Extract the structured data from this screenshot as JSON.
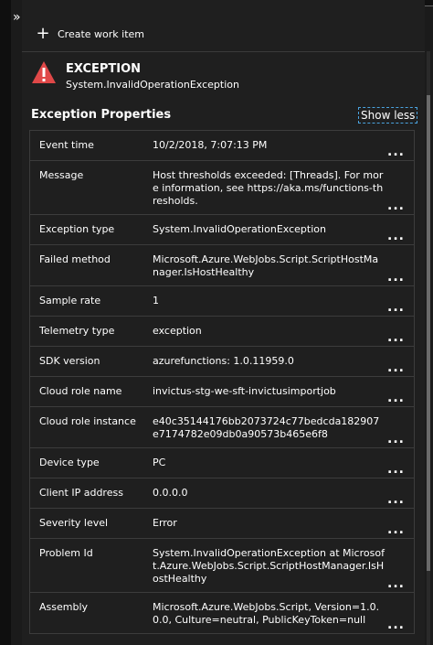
{
  "rail": {
    "expand_glyph": "»"
  },
  "toolbar": {
    "create_label": "Create work item",
    "create_icon": "plus-icon"
  },
  "exception": {
    "title": "EXCEPTION",
    "type": "System.InvalidOperationException",
    "icon": "warning-icon",
    "icon_color": "#e04848"
  },
  "section": {
    "title": "Exception Properties",
    "toggle_label": "Show less"
  },
  "properties": [
    {
      "key": "Event time",
      "value": "10/2/2018, 7:07:13 PM"
    },
    {
      "key": "Message",
      "value": "Host thresholds exceeded: [Threads]. For more information, see https://aka.ms/functions-thresholds."
    },
    {
      "key": "Exception type",
      "value": "System.InvalidOperationException"
    },
    {
      "key": "Failed method",
      "value": "Microsoft.Azure.WebJobs.Script.ScriptHostManager.IsHostHealthy"
    },
    {
      "key": "Sample rate",
      "value": "1"
    },
    {
      "key": "Telemetry type",
      "value": "exception"
    },
    {
      "key": "SDK version",
      "value": "azurefunctions: 1.0.11959.0"
    },
    {
      "key": "Cloud role name",
      "value": "invictus-stg-we-sft-invictusimportjob"
    },
    {
      "key": "Cloud role instance",
      "value": "e40c35144176bb2073724c77bedcda182907e7174782e09db0a90573b465e6f8"
    },
    {
      "key": "Device type",
      "value": "PC"
    },
    {
      "key": "Client IP address",
      "value": "0.0.0.0"
    },
    {
      "key": "Severity level",
      "value": "Error"
    },
    {
      "key": "Problem Id",
      "value": "System.InvalidOperationException at Microsoft.Azure.WebJobs.Script.ScriptHostManager.IsHostHealthy"
    },
    {
      "key": "Assembly",
      "value": "Microsoft.Azure.WebJobs.Script, Version=1.0.0.0, Culture=neutral, PublicKeyToken=null"
    }
  ],
  "row_menu_label": "..."
}
